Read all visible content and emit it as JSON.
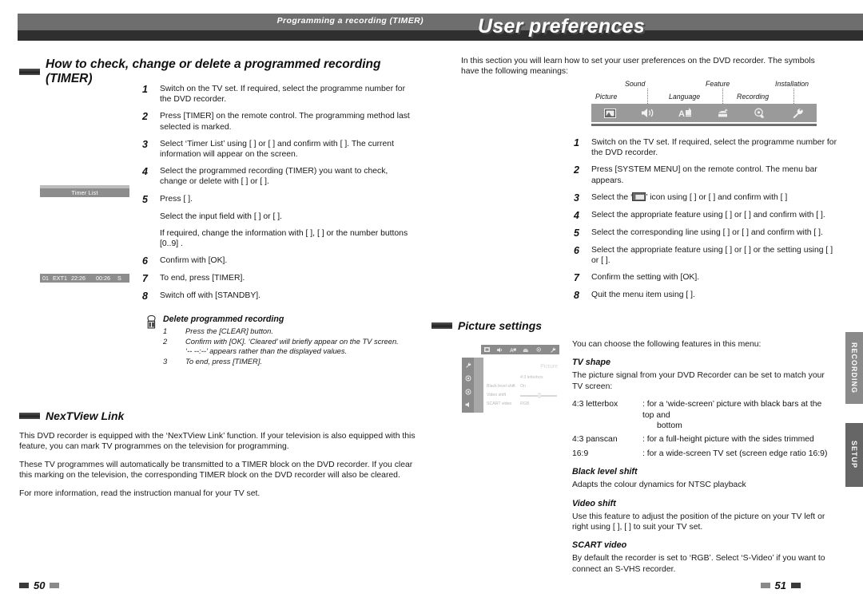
{
  "banner": {
    "running_head": "Programming a recording (TIMER)",
    "title": "User preferences"
  },
  "left": {
    "heading": "How to check, change or delete a programmed recording (TIMER)",
    "steps": [
      {
        "n": "1",
        "text": "Switch on the TV set. If required, select the programme number for the DVD recorder."
      },
      {
        "n": "2",
        "text": "Press [TIMER] on the remote control. The programming method last selected is marked."
      },
      {
        "n": "3",
        "text": "Select ‘Timer List’ using [ ] or [ ] and confirm with [ ]. The current information will appear on the screen."
      },
      {
        "n": "4",
        "text": "Select the programmed recording (TIMER) you want to check, change or delete with [ ] or [ ]."
      },
      {
        "n": "5",
        "text": "Press [ ]."
      },
      {
        "n": "6",
        "text": "Confirm with [OK]."
      },
      {
        "n": "7",
        "text": "To end, press [TIMER]."
      },
      {
        "n": "8",
        "text": "Switch off with [STANDBY]."
      }
    ],
    "substeps": [
      "Select the input field with [ ] or [ ].",
      "If required, change the information with [ ], [ ] or the number buttons [0..9] ."
    ],
    "tip": {
      "title": "Delete programmed recording",
      "items": [
        {
          "n": "1",
          "text": "Press the [CLEAR] button."
        },
        {
          "n": "2",
          "text": "Confirm with [OK]. ‘Cleared’ will briefly appear on the TV screen."
        }
      ],
      "note": "‘-- --:--’ appears rather than the displayed values.",
      "last": {
        "n": "3",
        "text": "To end, press [TIMER]."
      }
    },
    "tv_screen": {
      "header": "Timer List",
      "row": [
        "01",
        "EXT1",
        "22:26",
        "00:26",
        "S"
      ]
    },
    "nextview": {
      "heading": "NexTView Link",
      "paragraphs": [
        "This DVD recorder is equipped with the ‘NexTView Link’ function. If your television is also equipped with this feature, you can mark TV programmes on the television for programming.",
        "These TV programmes will automatically be transmitted to a TIMER block on the DVD recorder. If you clear this marking on the television, the corresponding TIMER block on the DVD recorder will also be cleared.",
        "For more information, read the instruction manual for your TV set."
      ]
    }
  },
  "right": {
    "intro": "In this section you will learn how to set your user preferences on the DVD recorder. The symbols have the following meanings:",
    "symbolbar": {
      "labels_top": [
        "Sound",
        "Feature",
        "Installation"
      ],
      "labels_bottom": [
        "Picture",
        "Language",
        "Recording"
      ],
      "icons": [
        "picture-icon",
        "sound-icon",
        "language-icon",
        "feature-icon",
        "recording-icon",
        "installation-icon"
      ]
    },
    "steps": [
      {
        "n": "1",
        "text": "Switch on the TV set. If required, select the programme number for the DVD recorder."
      },
      {
        "n": "2",
        "text": "Press [SYSTEM MENU] on the remote control. The menu bar appears."
      },
      {
        "n": "3",
        "text_pre": "Select the ‘",
        "text_post": "’ icon using [ ] or [ ] and confirm with [ ]"
      },
      {
        "n": "4",
        "text": "Select the appropriate feature using [ ] or [ ] and confirm with [ ]."
      },
      {
        "n": "5",
        "text": "Select the corresponding line using [ ] or [ ] and confirm with [ ]."
      },
      {
        "n": "6",
        "text": "Select the appropriate feature using [ ] or [ ] or the setting using [ ] or [ ]."
      },
      {
        "n": "7",
        "text": "Confirm the setting with [OK]."
      },
      {
        "n": "8",
        "text": "Quit the menu item using [ ]."
      }
    ],
    "picture_settings": {
      "heading": "Picture settings",
      "osd": {
        "title": "Picture",
        "rows": [
          {
            "label": "",
            "value": "4:3 letterbox"
          },
          {
            "label": "Black level shift",
            "value": "On"
          },
          {
            "label": "Video shift",
            "value": ""
          },
          {
            "label": "SCART video",
            "value": "RGB"
          }
        ]
      },
      "intro": "You can choose the following features in this menu:",
      "tv_shape": {
        "heading": "TV shape",
        "body": "The picture signal from your DVD Recorder can be set to match your TV screen:",
        "options": [
          {
            "key": "4:3 letterbox",
            "sep": ":",
            "value": "for a ‘wide-screen’ picture with black bars at the top and",
            "cont": "bottom"
          },
          {
            "key": "4:3 panscan",
            "sep": ":",
            "value": "for a full-height picture with the sides trimmed",
            "cont": ""
          },
          {
            "key": "16:9",
            "sep": ":",
            "value": "for a wide-screen TV set (screen edge ratio 16:9)",
            "cont": ""
          }
        ]
      },
      "black_level": {
        "heading": "Black level shift",
        "body": "Adapts the colour dynamics for NTSC playback"
      },
      "video_shift": {
        "heading": "Video shift",
        "body": "Use this feature to adjust the position of the picture on your TV left or right using [ ], [ ] to suit your TV set."
      },
      "scart_video": {
        "heading": "SCART video",
        "body": "By default the recorder is set to ‘RGB’. Select ‘S-Video’ if you want to connect an S-VHS recorder."
      }
    }
  },
  "edge_tabs": [
    {
      "label": "RECORDING"
    },
    {
      "label": "SETUP"
    }
  ],
  "footer": {
    "left_page": "50",
    "right_page": "51"
  },
  "colors": {
    "banner_grey": "#6e6e6e",
    "banner_dark": "#2f2f2f",
    "symbol_strip": "#9a9a9a",
    "tab_active": "#8a8a8a",
    "tab_inactive": "#666666"
  }
}
